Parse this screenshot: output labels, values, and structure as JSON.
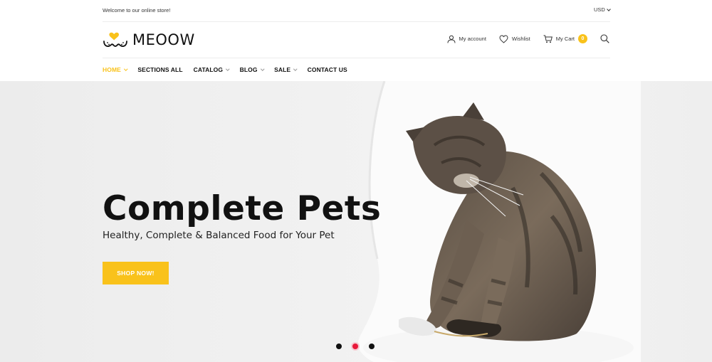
{
  "topbar": {
    "welcome": "Welcome to our online store!",
    "currency": "USD"
  },
  "header": {
    "logo_text": "MEOOW",
    "account": "My account",
    "wishlist": "Wishlist",
    "cart": "My Cart",
    "cart_count": "0",
    "icons": [
      "user-icon",
      "heart-icon",
      "cart-icon",
      "search-icon"
    ]
  },
  "nav": {
    "items": [
      {
        "label": "HOME",
        "active": true,
        "has_dropdown": true
      },
      {
        "label": "SECTIONS ALL",
        "active": false,
        "has_dropdown": false
      },
      {
        "label": "CATALOG",
        "active": false,
        "has_dropdown": true
      },
      {
        "label": "BLOG",
        "active": false,
        "has_dropdown": true
      },
      {
        "label": "SALE",
        "active": false,
        "has_dropdown": true
      },
      {
        "label": "CONTACT US",
        "active": false,
        "has_dropdown": false
      }
    ]
  },
  "hero": {
    "title": "Complete Pets",
    "subtitle": "Healthy, Complete & Balanced Food for Your Pet",
    "cta": "SHOP NOW!",
    "slides": 3,
    "active_slide": 2
  },
  "colors": {
    "accent": "#f9c21b",
    "active_dot": "#e8193a",
    "text": "#111111"
  }
}
